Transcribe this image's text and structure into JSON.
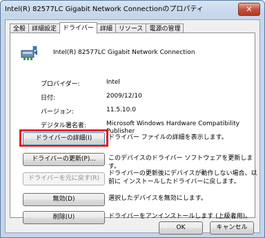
{
  "window": {
    "title": "Intel(R) 82577LC Gigabit Network Connectionのプロパティ",
    "close_label": "✕"
  },
  "tabs": [
    {
      "label": "全般"
    },
    {
      "label": "詳細設定"
    },
    {
      "label": "ドライバー"
    },
    {
      "label": "詳細"
    },
    {
      "label": "リソース"
    },
    {
      "label": "電源の管理"
    }
  ],
  "device": {
    "icon": "network-adapter-icon",
    "name": "Intel(R) 82577LC Gigabit Network Connection"
  },
  "info": [
    {
      "label": "プロバイダー:",
      "value": "Intel"
    },
    {
      "label": "日付:",
      "value": "2009/12/10"
    },
    {
      "label": "バージョン:",
      "value": "11.5.10.0"
    },
    {
      "label": "デジタル署名者:",
      "value": "Microsoft Windows Hardware Compatibility Publisher"
    }
  ],
  "actions": [
    {
      "button": "ドライバーの詳細(I)",
      "desc": "ドライバー ファイルの詳細を表示します。"
    },
    {
      "button": "ドライバーの更新(P)...",
      "desc": "このデバイスのドライバー ソフトウェアを更新します。"
    },
    {
      "button": "ドライバーを元に戻す(R)",
      "desc": "ドライバーの更新後にデバイスが動作しない場合、以前に インストールしたドライバーに戻します。"
    },
    {
      "button": "無効(D)",
      "desc": "選択したデバイスを無効にします。"
    },
    {
      "button": "削除(U)",
      "desc": "ドライバーをアンインストールします (上級者用)。"
    }
  ],
  "footer": {
    "ok": "OK",
    "cancel": "キャンセル"
  },
  "colors": {
    "highlight": "#e8141b"
  }
}
